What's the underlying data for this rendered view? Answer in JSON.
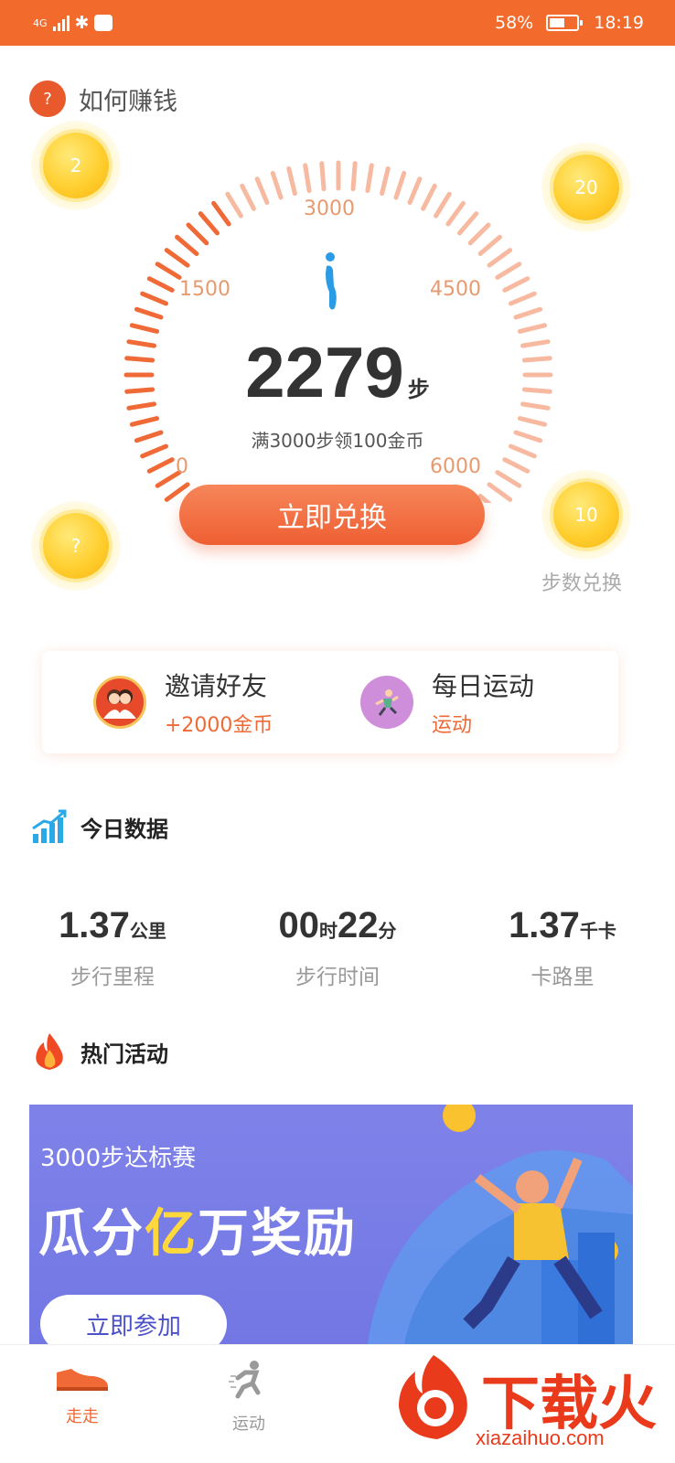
{
  "status_bar": {
    "network": "4G",
    "battery": "58%",
    "battery_level": 0.58,
    "time": "18:19",
    "color": "#f36a2d"
  },
  "header": {
    "help_icon": "question-icon",
    "help_label": "如何赚钱"
  },
  "coins": [
    {
      "value": "2"
    },
    {
      "value": "20"
    },
    {
      "value": "?"
    },
    {
      "value": "10"
    }
  ],
  "coin_caption": "步数兑换",
  "gauge": {
    "ticks": [
      "0",
      "1500",
      "3000",
      "4500",
      "6000"
    ],
    "steps": "2279",
    "max": 6000,
    "steps_unit": "步",
    "subtitle": "满3000步领100金币",
    "accent": "#ef6a36"
  },
  "exchange_button": "立即兑换",
  "actions": [
    {
      "title": "邀请好友",
      "subtitle": "+2000金币",
      "icon": "invite-friends-icon"
    },
    {
      "title": "每日运动",
      "subtitle": "运动",
      "icon": "daily-sport-icon"
    }
  ],
  "today": {
    "title": "今日数据",
    "icon": "chart-icon",
    "stats": [
      {
        "value": "1.37",
        "unit": "公里",
        "label": "步行里程"
      },
      {
        "value_parts": [
          "00",
          "时",
          "22",
          "分"
        ],
        "label": "步行时间"
      },
      {
        "value": "1.37",
        "unit": "千卡",
        "label": "卡路里"
      }
    ]
  },
  "hot": {
    "title": "热门活动",
    "icon": "flame-icon",
    "banner": {
      "small": "3000步达标赛",
      "big_1": "瓜分",
      "big_hl": "亿",
      "big_2": "万奖励",
      "button": "立即参加",
      "color": "#7377e4"
    }
  },
  "tabs": [
    {
      "label": "走走",
      "icon": "shoe-icon",
      "active": true
    },
    {
      "label": "运动",
      "icon": "runner-icon",
      "active": false
    }
  ],
  "watermark": {
    "text": "下载火",
    "url": "xiazaihuo.com"
  }
}
